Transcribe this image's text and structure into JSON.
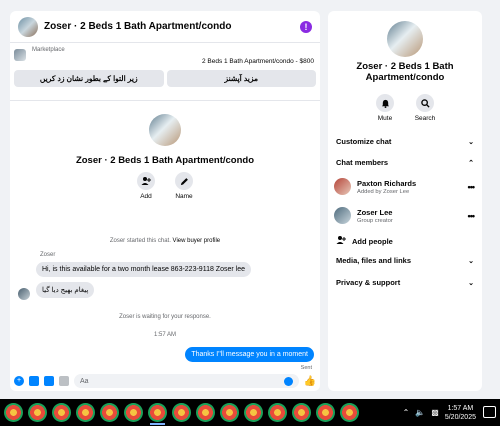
{
  "chat": {
    "header_title": "Zoser · 2 Beds 1 Bath Apartment/condo",
    "more_icon": "!",
    "marketplace_label": "Marketplace",
    "listing_price": "2 Beds 1 Bath Apartment/condo - $800",
    "btn_under_review": "زیر التوا کے بطور نشان زد کریں",
    "btn_more_options": "مزید آپشنز",
    "conv_title": "Zoser · 2 Beds 1 Bath Apartment/condo",
    "add_label": "Add",
    "name_label": "Name",
    "started_text": "Zoser started this chat.",
    "view_profile": "View buyer profile",
    "sender_name": "Zoser",
    "msg1": "Hi, is this available for a two month lease 863-223-9118 Zoser lee",
    "msg2": "پیغام بھیج دیا گیا",
    "waiting_text": "Zoser is waiting for your response.",
    "time_text": "1:57 AM",
    "msg_out": "Thanks I''ll message you in a moment",
    "sent_label": "Sent",
    "composer_placeholder": "Aa"
  },
  "info": {
    "title": "Zoser · 2 Beds 1 Bath Apartment/condo",
    "mute_label": "Mute",
    "search_label": "Search",
    "customize_chat": "Customize chat",
    "chat_members": "Chat members",
    "members": [
      {
        "name": "Paxton Richards",
        "sub": "Added by Zoser Lee",
        "color": "#b5453a"
      },
      {
        "name": "Zoser Lee",
        "sub": "Group creator",
        "color": "#4f6b7d"
      }
    ],
    "add_people": "Add people",
    "media_files_links": "Media, files and links",
    "privacy_support": "Privacy & support"
  },
  "taskbar": {
    "time": "1:57 AM",
    "date": "5/20/2025",
    "app_count": 15
  },
  "colors": {
    "accent": "#0084ff",
    "more_purple": "#8a2be2"
  }
}
